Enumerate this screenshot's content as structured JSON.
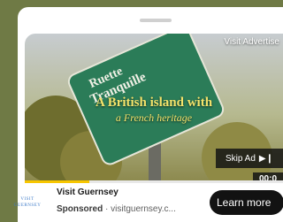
{
  "ad": {
    "visit_advertiser": "Visit Advertise",
    "headline_line1": "A British island with",
    "headline_line2": "a French heritage",
    "sign_line1": "Ruette",
    "sign_line2": "Tranquille",
    "skip_label": "Skip Ad",
    "timer": "00:0",
    "progress_fraction": 0.25
  },
  "advertiser": {
    "logo_line1": "VISIT",
    "logo_line2": "GUERNSEY",
    "name": "Visit Guernsey",
    "sponsored_label": "Sponsored",
    "domain": "visitguernsey.c..."
  },
  "cta": {
    "label": "Learn more"
  },
  "colors": {
    "background": "#6f7a45",
    "accent_progress": "#f7c600",
    "cta_bg": "#121212",
    "headline": "#f4e36b"
  }
}
